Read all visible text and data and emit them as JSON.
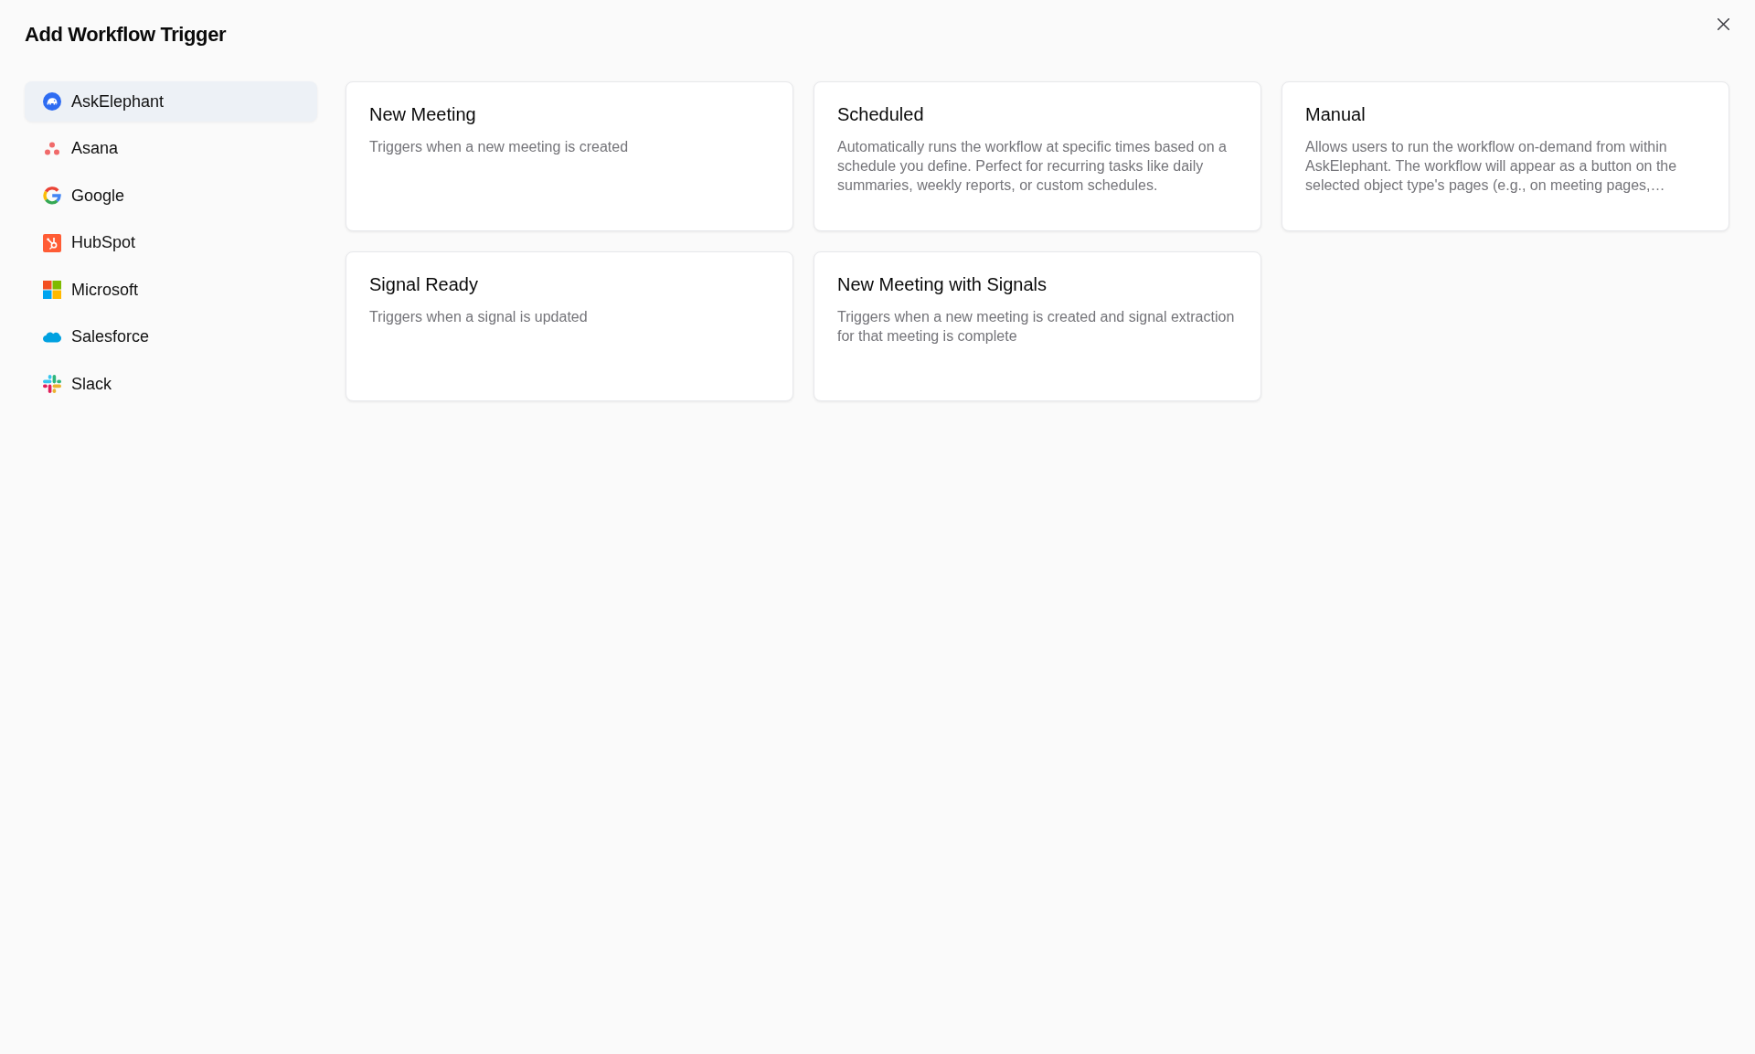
{
  "dialog": {
    "title": "Add Workflow Trigger"
  },
  "sidebar": {
    "items": [
      {
        "label": "AskElephant",
        "selected": true
      },
      {
        "label": "Asana",
        "selected": false
      },
      {
        "label": "Google",
        "selected": false
      },
      {
        "label": "HubSpot",
        "selected": false
      },
      {
        "label": "Microsoft",
        "selected": false
      },
      {
        "label": "Salesforce",
        "selected": false
      },
      {
        "label": "Slack",
        "selected": false
      }
    ]
  },
  "triggers": [
    {
      "title": "New Meeting",
      "description": "Triggers when a new meeting is created"
    },
    {
      "title": "Scheduled",
      "description": "Automatically runs the workflow at specific times based on a schedule you define. Perfect for recurring tasks like daily summaries, weekly reports, or custom schedules."
    },
    {
      "title": "Manual",
      "description": "Allows users to run the workflow on-demand from within AskElephant. The workflow will appear as a button on the selected object type's pages (e.g., on meeting pages,…"
    },
    {
      "title": "Signal Ready",
      "description": "Triggers when a signal is updated"
    },
    {
      "title": "New Meeting with Signals",
      "description": "Triggers when a new meeting is created and signal extraction for that meeting is complete"
    }
  ]
}
